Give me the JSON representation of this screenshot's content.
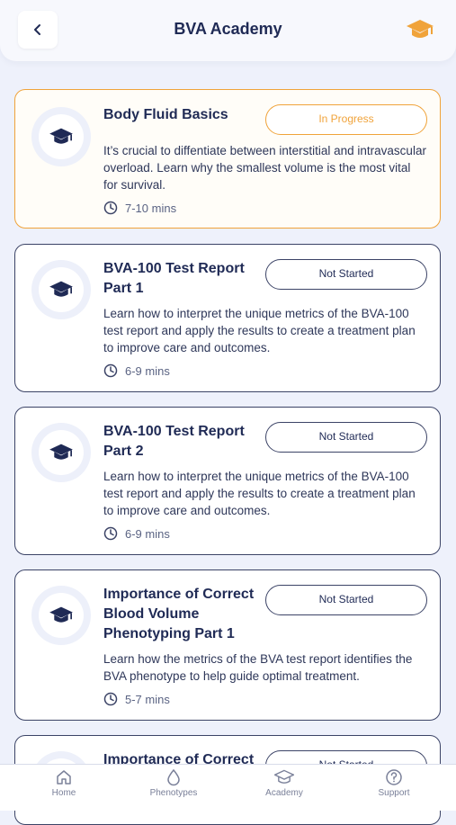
{
  "header": {
    "title": "BVA Academy",
    "back_icon": "chevron-left-icon",
    "academy_icon": "graduation-cap-icon",
    "accent_color": "#f0a33a"
  },
  "courses": [
    {
      "title": "Body Fluid Basics",
      "status": "In Progress",
      "description": "It’s crucial to diffentiate between interstitial and intravascular overload. Learn why the smallest volume is the most vital for survival.",
      "duration": "7-10 mins"
    },
    {
      "title": "BVA-100 Test Report Part 1",
      "status": "Not Started",
      "description": "Learn how to interpret the unique metrics of the BVA-100 test report and apply the results to create a treatment plan to improve care and outcomes.",
      "duration": "6-9 mins"
    },
    {
      "title": "BVA-100 Test Report Part 2",
      "status": "Not Started",
      "description": "Learn how to interpret the unique metrics of the BVA-100 test report and apply the results to create a treatment plan to improve care and outcomes.",
      "duration": "6-9 mins"
    },
    {
      "title": "Importance of Correct Blood Volume Phenotyping Part 1",
      "status": "Not Started",
      "description": "Learn how the metrics of the BVA test report identifies the BVA phenotype to help guide optimal treatment.",
      "duration": "5-7 mins"
    },
    {
      "title": "Importance of Correct",
      "status": "Not Started"
    }
  ],
  "tabbar": {
    "home": "Home",
    "phenotypes": "Phenotypes",
    "academy": "Academy",
    "support": "Support"
  }
}
